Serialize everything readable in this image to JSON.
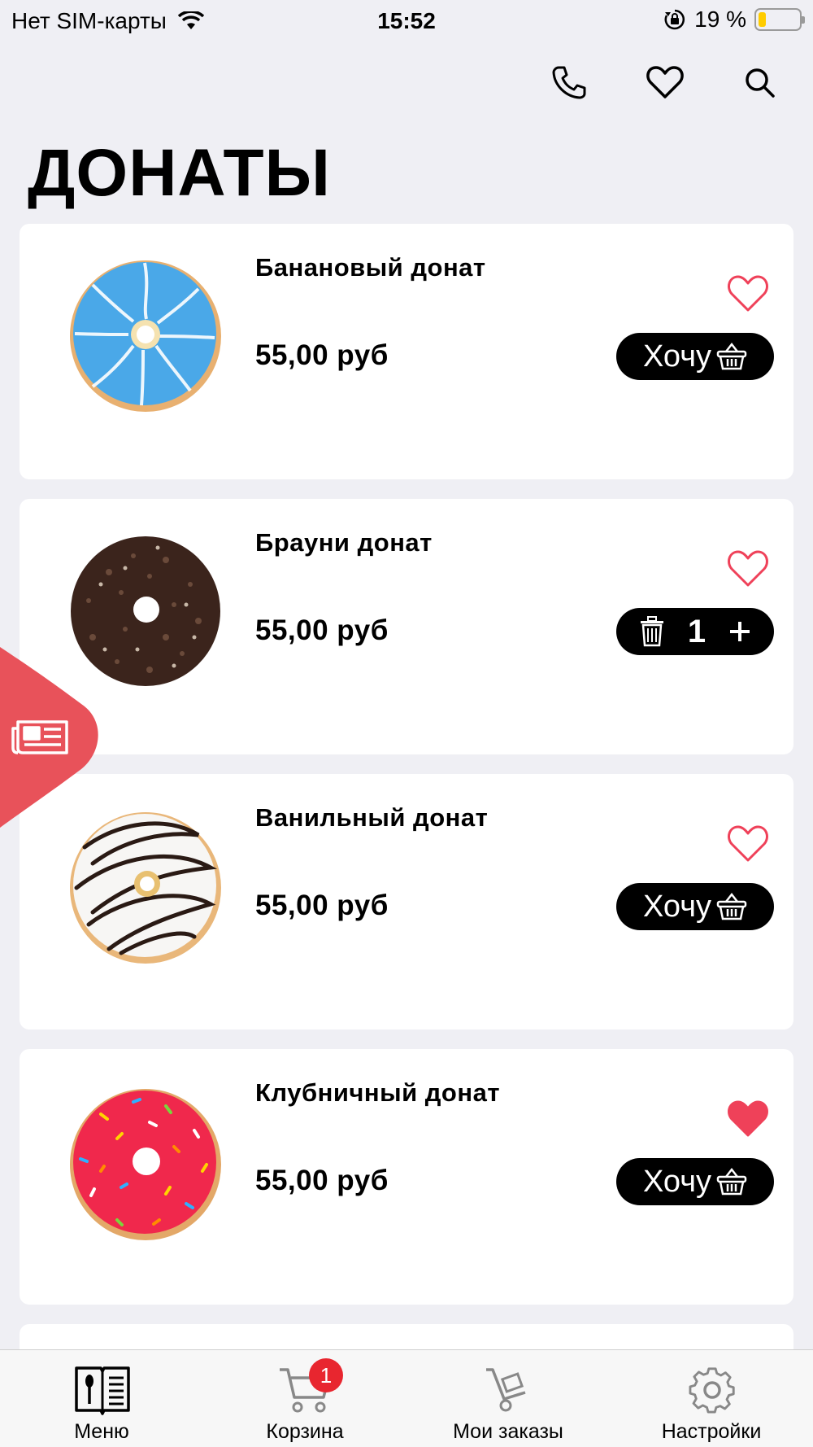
{
  "status_bar": {
    "carrier": "Нет SIM-карты",
    "time": "15:52",
    "battery_percent": "19 %"
  },
  "toolbar": {
    "icons": [
      "phone-icon",
      "heart-outline-icon",
      "search-icon"
    ]
  },
  "page": {
    "title": "ДОНАТЫ"
  },
  "products": [
    {
      "name": "Банановый донат",
      "price": "55,00 руб",
      "favorite": false,
      "action_label": "Хочу",
      "glaze_color": "#4aa8e8"
    },
    {
      "name": "Брауни донат",
      "price": "55,00 руб",
      "favorite": false,
      "quantity": "1",
      "glaze_color": "#3b241c"
    },
    {
      "name": "Ванильный донат",
      "price": "55,00 руб",
      "favorite": false,
      "action_label": "Хочу",
      "glaze_color": "#f7f6f4"
    },
    {
      "name": "Клубничный донат",
      "price": "55,00 руб",
      "favorite": true,
      "action_label": "Хочу",
      "glaze_color": "#f0284c"
    }
  ],
  "tab_bar": {
    "tabs": [
      {
        "label": "Меню",
        "icon": "menu-book-icon"
      },
      {
        "label": "Корзина",
        "icon": "cart-icon",
        "badge": "1"
      },
      {
        "label": "Мои заказы",
        "icon": "delivery-cart-icon"
      },
      {
        "label": "Настройки",
        "icon": "gear-icon"
      }
    ]
  },
  "colors": {
    "accent": "#e8525a",
    "heart": "#ef4159",
    "background": "#efeff4",
    "badge": "#e8262f"
  }
}
